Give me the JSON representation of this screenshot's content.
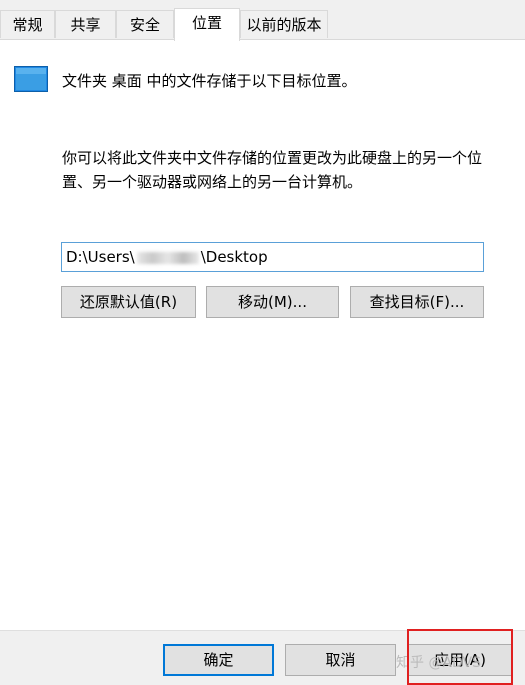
{
  "tabs": [
    {
      "label": "常规"
    },
    {
      "label": "共享"
    },
    {
      "label": "安全"
    },
    {
      "label": "位置",
      "active": true
    },
    {
      "label": "以前的版本"
    }
  ],
  "folder_info": "文件夹 桌面 中的文件存储于以下目标位置。",
  "description": "你可以将此文件夹中文件存储的位置更改为此硬盘上的另一个位置、另一个驱动器或网络上的另一台计算机。",
  "path": {
    "prefix": "D:\\Users\\",
    "suffix": "\\Desktop"
  },
  "buttons": {
    "restore_default": "还原默认值(R)",
    "move": "移动(M)...",
    "find_target": "查找目标(F)..."
  },
  "footer": {
    "ok": "确定",
    "cancel": "取消",
    "apply": "应用(A)"
  },
  "watermark": "知乎 @ADVS",
  "colors": {
    "accent": "#0078d7",
    "highlight_box": "#e02020",
    "folder_icon": "#3a9ee4"
  }
}
